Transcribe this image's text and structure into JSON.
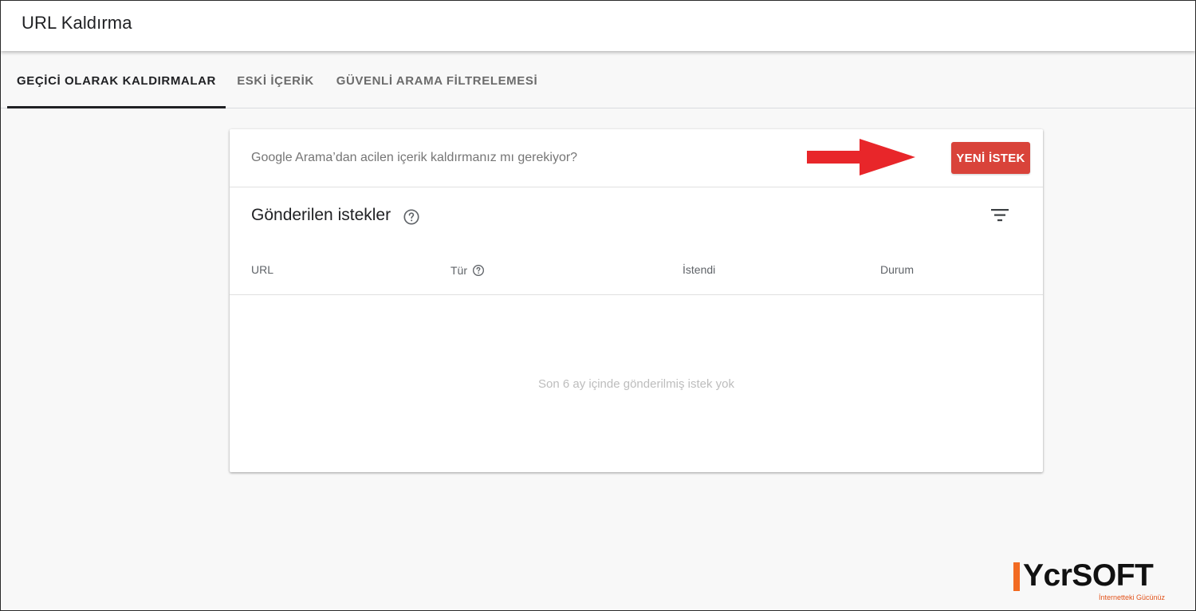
{
  "header": {
    "title": "URL Kaldırma"
  },
  "tabs": [
    {
      "label": "GEÇİCİ OLARAK KALDIRMALAR",
      "active": true
    },
    {
      "label": "ESKİ İÇERİK",
      "active": false
    },
    {
      "label": "GÜVENLİ ARAMA FİLTRELEMESİ",
      "active": false
    }
  ],
  "banner": {
    "text": "Google Arama’dan acilen içerik kaldırmanız mı gerekiyor?",
    "button_label": "YENİ İSTEK",
    "arrow_color": "#e8262a"
  },
  "requests": {
    "title": "Gönderilen istekler",
    "help_icon": "help-circle-icon",
    "filter_icon": "filter-list-icon",
    "columns": [
      {
        "label": "URL"
      },
      {
        "label": "Tür"
      },
      {
        "label": "İstendi"
      },
      {
        "label": "Durum"
      }
    ],
    "empty_message": "Son 6 ay içinde gönderilmiş istek yok"
  },
  "watermark": {
    "brand": "YcrSOFT",
    "tagline": "İnternetteki Gücünüz",
    "accent_color": "#f26b22"
  },
  "colors": {
    "primary_button": "#d9433a",
    "active_tab": "#202124"
  }
}
